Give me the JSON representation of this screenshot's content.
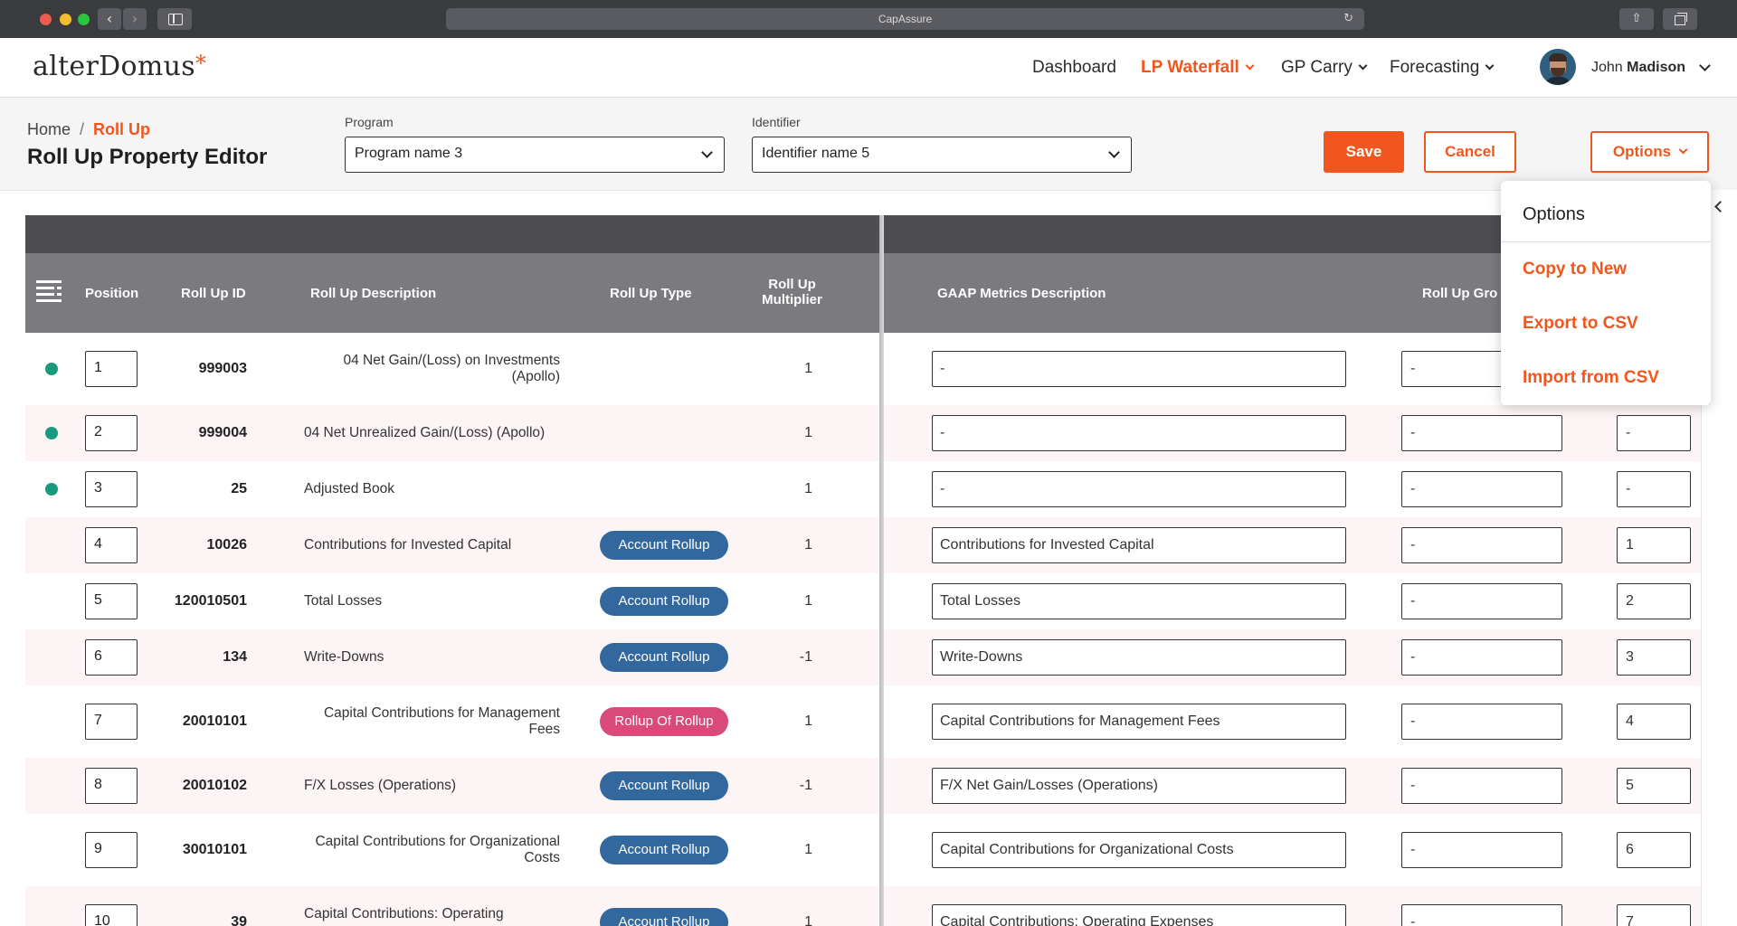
{
  "browser": {
    "url_title": "CapAssure",
    "back_icon": "chevron-left-icon",
    "forward_icon": "chevron-right-icon",
    "reload_icon": "reload-icon"
  },
  "header": {
    "logo_text": "alterDomus",
    "logo_star": "*",
    "nav": {
      "dashboard": "Dashboard",
      "lp_waterfall": "LP Waterfall",
      "gp_carry": "GP Carry",
      "forecasting": "Forecasting"
    },
    "user": {
      "first": "John",
      "last": "Madison"
    }
  },
  "subheader": {
    "breadcrumb": {
      "home": "Home",
      "sep": "/",
      "current": "Roll Up"
    },
    "title": "Roll Up Property Editor",
    "program": {
      "label": "Program",
      "value": "Program name 3"
    },
    "identifier": {
      "label": "Identifier",
      "value": "Identifier name 5"
    },
    "save_label": "Save",
    "cancel_label": "Cancel",
    "options_label": "Options"
  },
  "options_menu": {
    "title": "Options",
    "items": [
      "Copy to New",
      "Export to CSV",
      "Import from CSV"
    ]
  },
  "table": {
    "columns": {
      "position": "Position",
      "rollup_id": "Roll Up ID",
      "description": "Roll Up Description",
      "type": "Roll Up Type",
      "multiplier_1": "Roll Up",
      "multiplier_2": "Multiplier",
      "gaap": "GAAP Metrics Description",
      "group": "Roll Up Gro"
    },
    "rows": [
      {
        "pos": "1",
        "id": "999003",
        "desc": "04 Net Gain/(Loss) on Investments (Apollo)",
        "type": "",
        "mult": "1",
        "gaap": "-",
        "group": "-",
        "order": ""
      },
      {
        "pos": "2",
        "id": "999004",
        "desc": "04 Net Unrealized Gain/(Loss) (Apollo)",
        "type": "",
        "mult": "1",
        "gaap": "-",
        "group": "-",
        "order": "-"
      },
      {
        "pos": "3",
        "id": "25",
        "desc": "Adjusted Book",
        "type": "",
        "mult": "1",
        "gaap": "-",
        "group": "-",
        "order": "-"
      },
      {
        "pos": "4",
        "id": "10026",
        "desc": "Contributions for Invested Capital",
        "type": "Account Rollup",
        "mult": "1",
        "gaap": "Contributions for Invested Capital",
        "group": "-",
        "order": "1"
      },
      {
        "pos": "5",
        "id": "120010501",
        "desc": "Total Losses",
        "type": "Account Rollup",
        "mult": "1",
        "gaap": "Total Losses",
        "group": "-",
        "order": "2"
      },
      {
        "pos": "6",
        "id": "134",
        "desc": "Write-Downs",
        "type": "Account Rollup",
        "mult": "-1",
        "gaap": "Write-Downs",
        "group": "-",
        "order": "3"
      },
      {
        "pos": "7",
        "id": "20010101",
        "desc": "Capital Contributions for Management Fees",
        "type": "Rollup Of Rollup",
        "mult": "1",
        "gaap": "Capital Contributions for Management Fees",
        "group": "-",
        "order": "4"
      },
      {
        "pos": "8",
        "id": "20010102",
        "desc": "F/X Losses (Operations)",
        "type": "Account Rollup",
        "mult": "-1",
        "gaap": "F/X Net Gain/Losses (Operations)",
        "group": "-",
        "order": "5"
      },
      {
        "pos": "9",
        "id": "30010101",
        "desc": "Capital Contributions for Organizational Costs",
        "type": "Account Rollup",
        "mult": "1",
        "gaap": "Capital Contributions for Organizational Costs",
        "group": "-",
        "order": "6"
      },
      {
        "pos": "10",
        "id": "39",
        "desc": "Capital Contributions: Operating",
        "type": "Account Rollup",
        "mult": "1",
        "gaap": "Capital Contributions: Operating Expenses",
        "group": "-",
        "order": "7"
      }
    ],
    "status_dot_color": "#1a9a7d"
  },
  "colors": {
    "accent": "#f0561d",
    "pill_blue": "#33689e",
    "pill_pink": "#d9497a",
    "header_dark": "#4d4d52",
    "header_mid": "#7a7a7f"
  }
}
